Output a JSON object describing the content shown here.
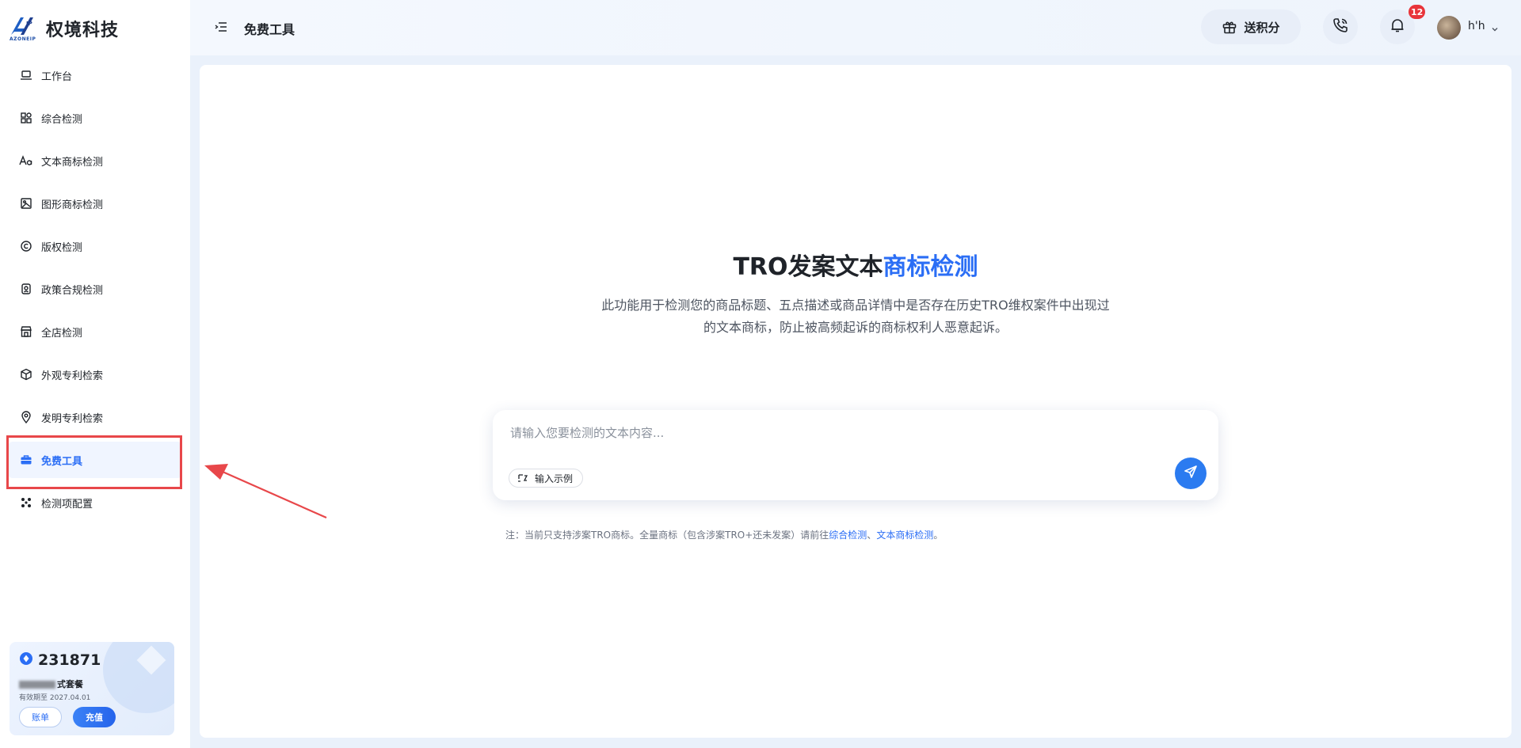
{
  "brand": {
    "name": "权境科技",
    "subtext": "AZONEIP",
    "mark_text": "IP"
  },
  "sidebar": {
    "items": [
      {
        "label": "工作台",
        "icon": "laptop-icon"
      },
      {
        "label": "综合检测",
        "icon": "grid-icon"
      },
      {
        "label": "文本商标检测",
        "icon": "text-aa-icon"
      },
      {
        "label": "图形商标检测",
        "icon": "image-icon"
      },
      {
        "label": "版权检测",
        "icon": "copyright-icon"
      },
      {
        "label": "政策合规检测",
        "icon": "policy-icon"
      },
      {
        "label": "全店检测",
        "icon": "store-icon"
      },
      {
        "label": "外观专利检索",
        "icon": "cube-icon"
      },
      {
        "label": "发明专利检索",
        "icon": "location-pin-icon"
      },
      {
        "label": "免费工具",
        "icon": "briefcase-icon",
        "active": true
      },
      {
        "label": "检测项配置",
        "icon": "cluster-icon"
      }
    ]
  },
  "points_card": {
    "points": "231871",
    "plan_suffix": "式套餐",
    "expiry": "有效期至 2027.04.01",
    "bill_label": "账单",
    "recharge_label": "充值"
  },
  "header": {
    "title": "免费工具",
    "gift_label": "送积分",
    "notification_count": "12",
    "username": "h'h"
  },
  "main": {
    "title_prefix": "TRO发案文本",
    "title_accent": "商标检测",
    "description_line1": "此功能用于检测您的商品标题、五点描述或商品详情中是否存在历史TRO维权案件中出现过",
    "description_line2": "的文本商标，防止被高频起诉的商标权利人恶意起诉。",
    "input_placeholder": "请输入您要检测的文本内容...",
    "example_label": "输入示例",
    "note_prefix": "注：当前只支持涉案TRO商标。全量商标（包含涉案TRO+还未发案）请前往",
    "note_link1": "综合检测",
    "note_sep": "、",
    "note_link2": "文本商标检测",
    "note_end": "。"
  },
  "colors": {
    "accent": "#2b6ef5",
    "highlight_box": "#e8474a",
    "badge": "#e8343a"
  }
}
